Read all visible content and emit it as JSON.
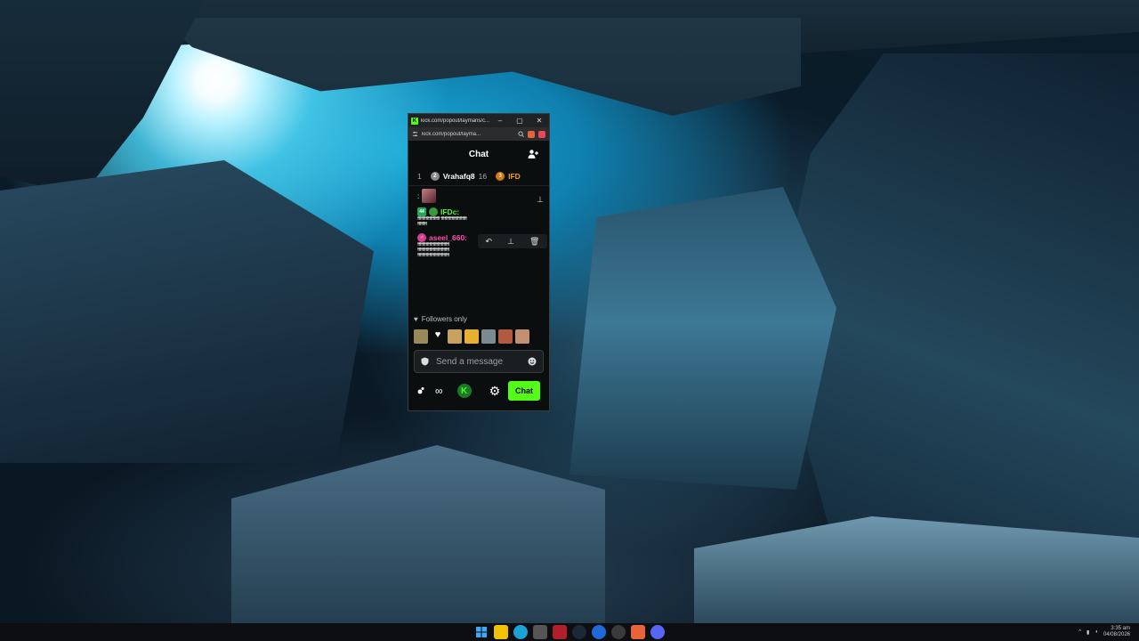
{
  "popout": {
    "titlebar": {
      "icon": "K",
      "title": "kick.com/popout/laymans/c...",
      "minimize": "–",
      "maximize": "▢",
      "close": "✕"
    },
    "urlbar": {
      "url": "kick.com/popout/layma..."
    },
    "header": {
      "title": "Chat"
    },
    "leaderboard": [
      {
        "rank": "1"
      },
      {
        "badge": "2",
        "name": "Vrahafq8",
        "count": "16",
        "color": "#8a8a8a"
      },
      {
        "badge": "3",
        "name": "IFD",
        "color": "#d97706"
      }
    ],
    "messages": [
      {
        "username": "IFDc:",
        "badge": "44",
        "color": "#53fc18",
        "lines": [
          "ɬɬɬɬɬɬɬɬɬɬɬɬɬɬɬɬɬɬɬ ɬɬɬɬɬɬɬɬɬɬɬɬɬɬɬɬɬɬɬɬɬɬ",
          "ɬɬɬɬɬɬɬɬ"
        ]
      },
      {
        "username": "aseel_660:",
        "color": "#ff4fb0",
        "lines": [
          "ɬɬɬɬɬɬɬɬɬɬɬɬɬɬɬɬɬɬɬɬɬɬɬɬɬɬɬ",
          "ɬɬɬɬɬɬɬɬɬɬɬɬɬɬɬɬɬɬɬɬɬɬɬɬɬɬɬ",
          "ɬɬɬɬɬɬɬɬɬɬɬɬɬɬɬɬɬɬɬɬɬɬɬɬɬɬɬ"
        ]
      }
    ],
    "hover_actions": [
      "↶",
      "⊥",
      "🗑"
    ],
    "followers_only": "Followers only",
    "input": {
      "placeholder": "Send a message"
    },
    "footer": {
      "chat_button": "Chat"
    }
  },
  "taskbar": {
    "time": "3:35 am",
    "date": "04/08/2026"
  },
  "colors": {
    "kick_green": "#53fc18"
  }
}
